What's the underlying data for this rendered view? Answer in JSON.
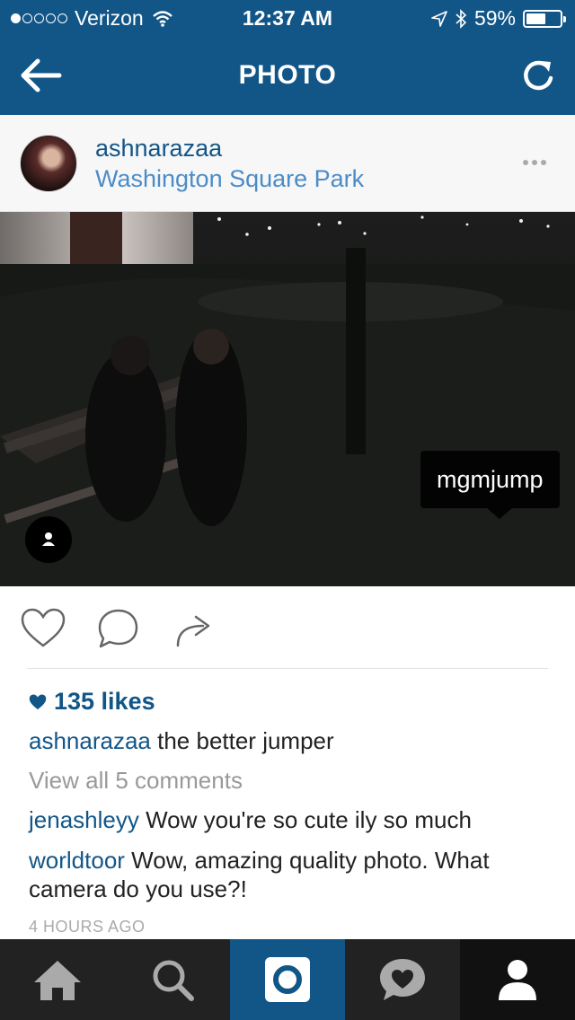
{
  "status_bar": {
    "carrier": "Verizon",
    "time": "12:37 AM",
    "battery": "59%",
    "battery_level": 0.59,
    "signal_bars_filled": 1,
    "signal_bars_total": 5
  },
  "nav": {
    "title": "PHOTO",
    "back_icon": "back-arrow-icon",
    "refresh_icon": "refresh-icon",
    "color": "#125688"
  },
  "post": {
    "username": "ashnarazaa",
    "location": "Washington Square Park",
    "tag": "mgmjump",
    "likes": "135 likes",
    "caption_user": "ashnarazaa",
    "caption_text": " the better jumper",
    "view_all": "View all 5 comments",
    "comments": [
      {
        "user": "jenashleyy",
        "text": " Wow you're so cute ily so much"
      },
      {
        "user": "worldtoor",
        "text": " Wow, amazing quality photo. What camera do you use?!"
      }
    ],
    "time_ago": "4 HOURS AGO"
  },
  "actions": [
    "heart-icon",
    "comment-icon",
    "share-icon"
  ],
  "tabs": [
    "home-icon",
    "search-icon",
    "camera-icon",
    "activity-icon",
    "profile-icon"
  ],
  "colors": {
    "brand": "#125688",
    "link": "#4b8cc8",
    "muted": "#999999"
  }
}
